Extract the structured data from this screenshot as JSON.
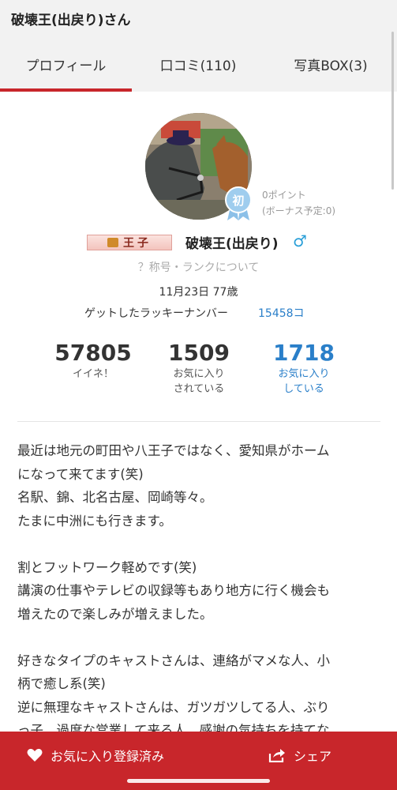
{
  "header": {
    "title": "破壊王(出戻り)さん"
  },
  "tabs": [
    {
      "label": "プロフィール",
      "active": true
    },
    {
      "label": "口コミ(110)"
    },
    {
      "label": "写真BOX(3)"
    }
  ],
  "profile": {
    "rank_badge": "初",
    "points": "0ポイント",
    "bonus": "(ボーナス予定:0)",
    "title_badge": "王子",
    "name": "破壊王(出戻り)",
    "gender_symbol": "♂",
    "rank_link": "？称号・ランクについて",
    "birth": "11月23日 77歳",
    "lucky_label": "ゲットしたラッキーナンバー",
    "lucky_value": "15458コ"
  },
  "stats": [
    {
      "value": "57805",
      "label": "イイネ！"
    },
    {
      "value": "1509",
      "label": "お気に入り\nされている"
    },
    {
      "value": "1718",
      "label": "お気に入り\nしている"
    }
  ],
  "bio": [
    "最近は地元の町田や八王子ではなく、愛知県がホーム",
    "になって来てます(笑)",
    "名駅、錦、北名古屋、岡崎等々。",
    "たまに中洲にも行きます。",
    "",
    "割とフットワーク軽めです(笑)",
    "講演の仕事やテレビの収録等もあり地方に行く機会も",
    "増えたので楽しみが増えました。",
    "",
    "好きなタイプのキャストさんは、連絡がマメな人、小",
    "柄で癒し系(笑)",
    "逆に無理なキャストさんは、ガツガツしてる人、ぶり",
    "っ子、過度な営業して来る人、感謝の気持ちを持てな"
  ],
  "bottom_bar": {
    "favorite_label": "お気に入り登録済み",
    "share_label": "シェア"
  },
  "colors": {
    "accent_red": "#c8262b",
    "link_blue": "#2a7fc9",
    "gender_blue": "#2a9fd8"
  }
}
